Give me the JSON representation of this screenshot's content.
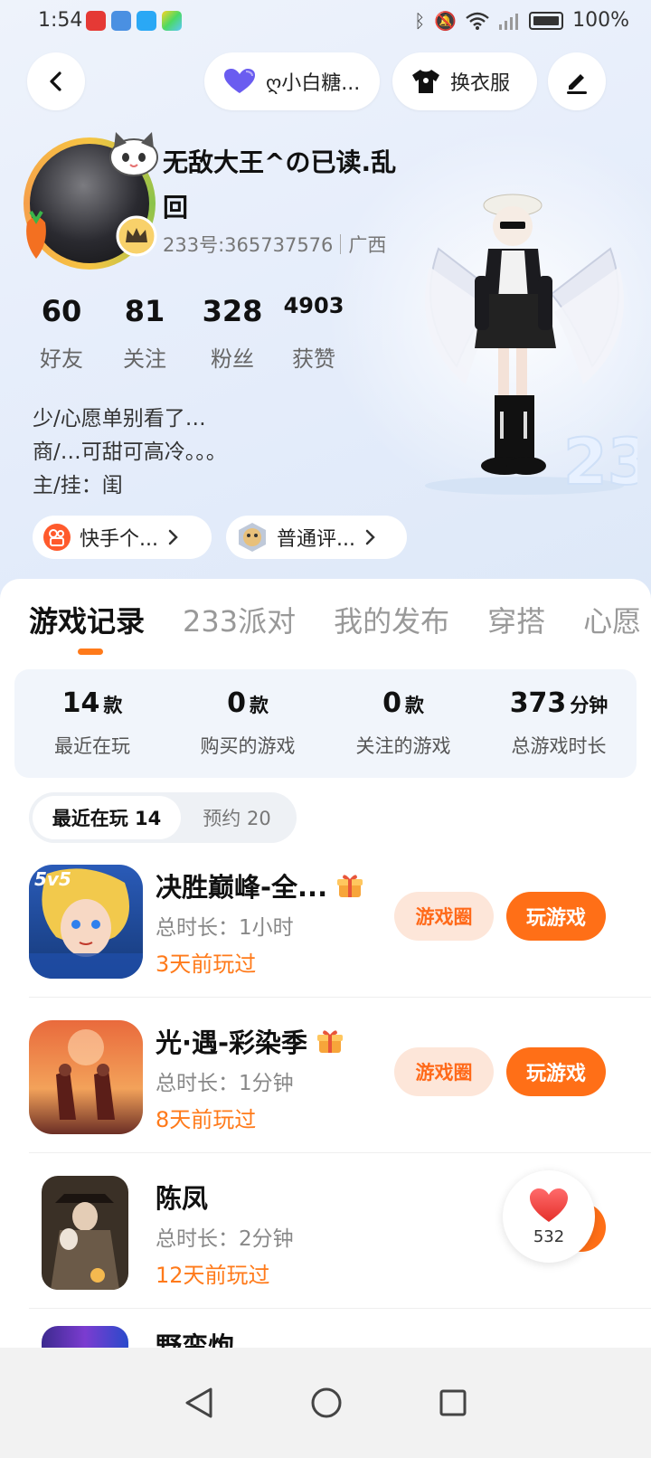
{
  "status_bar": {
    "time": "1:54",
    "battery": "100%"
  },
  "header": {
    "circle_name": "ღ小白糖...",
    "dress_label": "换衣服"
  },
  "profile": {
    "nickname": "无敌大王^の已读.乱回",
    "uid": "233号:365737576",
    "region": "广西",
    "stats": [
      {
        "value": "60",
        "label": "好友"
      },
      {
        "value": "81",
        "label": "关注"
      },
      {
        "value": "328",
        "label": "粉丝"
      },
      {
        "value": "4903",
        "label": "获赞"
      }
    ],
    "bio": [
      "少/心愿单别看了…",
      "商/…可甜可高冷。。。",
      "主/挂：闺"
    ],
    "chips": [
      {
        "label": "快手个..."
      },
      {
        "label": "普通评..."
      }
    ]
  },
  "tabs": [
    "游戏记录",
    "233派对",
    "我的发布",
    "穿搭",
    "心愿"
  ],
  "summary": [
    {
      "value": "14",
      "unit": "款",
      "label": "最近在玩"
    },
    {
      "value": "0",
      "unit": "款",
      "label": "购买的游戏"
    },
    {
      "value": "0",
      "unit": "款",
      "label": "关注的游戏"
    },
    {
      "value": "373",
      "unit": "分钟",
      "label": "总游戏时长"
    }
  ],
  "segments": {
    "recent": "最近在玩 14",
    "reserve": "预约 20"
  },
  "games": [
    {
      "title": "决胜巅峰-全...",
      "duration": "总时长：1小时",
      "last": "3天前玩过",
      "circle": "游戏圈",
      "play": "玩游戏",
      "icon_text": "5v5"
    },
    {
      "title": "光·遇-彩染季",
      "duration": "总时长：1分钟",
      "last": "8天前玩过",
      "circle": "游戏圈",
      "play": "玩游戏"
    },
    {
      "title": "陈凤",
      "duration": "总时长：2分钟",
      "last": "12天前玩过"
    },
    {
      "title": "野蛮炮"
    }
  ],
  "like_count": "532",
  "colors": {
    "accent": "#ff6f17",
    "accent_soft": "#fde6d9",
    "summary_bg": "#f1f5fb"
  },
  "icons": [
    "back-icon",
    "heart-icon",
    "tshirt-icon",
    "edit-icon",
    "gift-icon",
    "chevron-right-icon",
    "like-heart-icon",
    "nav-back-icon",
    "nav-home-icon",
    "nav-recent-icon"
  ]
}
